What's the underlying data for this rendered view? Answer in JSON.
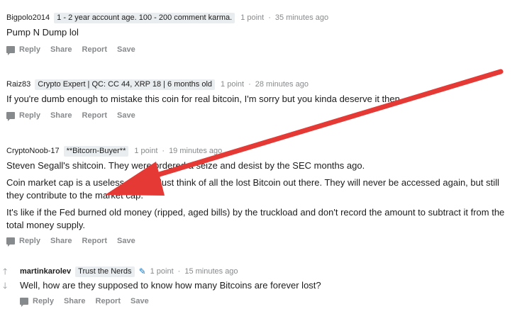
{
  "comments": [
    {
      "author": "Bigpolo2014",
      "flair": "1 - 2 year account age. 100 - 200 comment karma.",
      "points": "1 point",
      "time": "35 minutes ago",
      "paragraphs": [
        "Pump N Dump lol"
      ]
    },
    {
      "author": "Raiz83",
      "flair": "Crypto Expert | QC: CC 44, XRP 18 | 6 months old",
      "points": "1 point",
      "time": "28 minutes ago",
      "paragraphs": [
        "If you're dumb enough to mistake this coin for real bitcoin, I'm sorry but you kinda deserve it then"
      ]
    },
    {
      "author": "CryptoNoob-17",
      "flair": "**Bitcorn-Buyer**",
      "points": "1 point",
      "time": "19 minutes ago",
      "paragraphs": [
        "Steven Segall's shitcoin. They were ordered a seize and desist by the SEC months ago.",
        "Coin market cap is a useless metric. Just think of all the lost Bitcoin out there. They will never be accessed again, but still they contribute to the market cap.",
        "It's like if the Fed burned old money (ripped, aged bills) by the truckload and don't record the amount to subtract it from the total money supply."
      ]
    },
    {
      "author": "martinkarolev",
      "flair": "Trust the Nerds",
      "points": "1 point",
      "time": "15 minutes ago",
      "paragraphs": [
        "Well, how are they supposed to know how many Bitcoins are forever lost?"
      ]
    }
  ],
  "actions": {
    "reply": "Reply",
    "share": "Share",
    "report": "Report",
    "save": "Save"
  },
  "separator": "·",
  "icons": {
    "reply": "speech-bubble-icon",
    "upvote": "upvote-arrow-icon",
    "downvote": "downvote-arrow-icon",
    "flair_emoji": "pencil-icon"
  },
  "colors": {
    "annotation_arrow": "#e53935",
    "meta_text": "#878a8c",
    "flair_bg": "#eaedef",
    "flair_emoji": "#0079d3"
  }
}
